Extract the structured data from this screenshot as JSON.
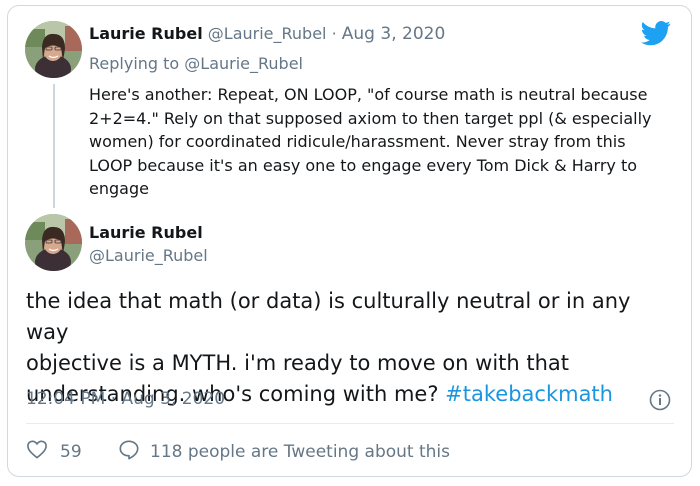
{
  "reply_tweet": {
    "author_name": "Laurie Rubel",
    "author_handle": "@Laurie_Rubel",
    "separator": "·",
    "date": "Aug 3, 2020",
    "replying_to": "Replying to @Laurie_Rubel",
    "body": "Here's another: Repeat, ON LOOP, \"of course math is neutral because\n2+2=4.\" Rely on that supposed axiom to then target ppl (& especially\nwomen) for coordinated ridicule/harassment. Never stray from this\nLOOP because it's an easy one to engage every Tom Dick & Harry to\nengage"
  },
  "main_tweet": {
    "author_name": "Laurie Rubel",
    "author_handle": "@Laurie_Rubel",
    "text": "the idea that math (or data) is culturally neutral or in any way\nobjective is a MYTH. i'm ready to move on with that\nunderstanding. who's coming with me? ",
    "hashtag": "#takebackmath",
    "timestamp": "12:04 PM · Aug 3, 2020",
    "likes": "59",
    "tweeting_about": "118 people are Tweeting about this"
  },
  "colors": {
    "twitter_blue": "#1da1f2",
    "hashtag_blue": "#1b95e0",
    "muted_gray": "#657786"
  },
  "icons": {
    "logo": "twitter-bird-icon",
    "info": "info-icon",
    "like": "heart-icon",
    "reply": "speech-bubble-icon"
  }
}
